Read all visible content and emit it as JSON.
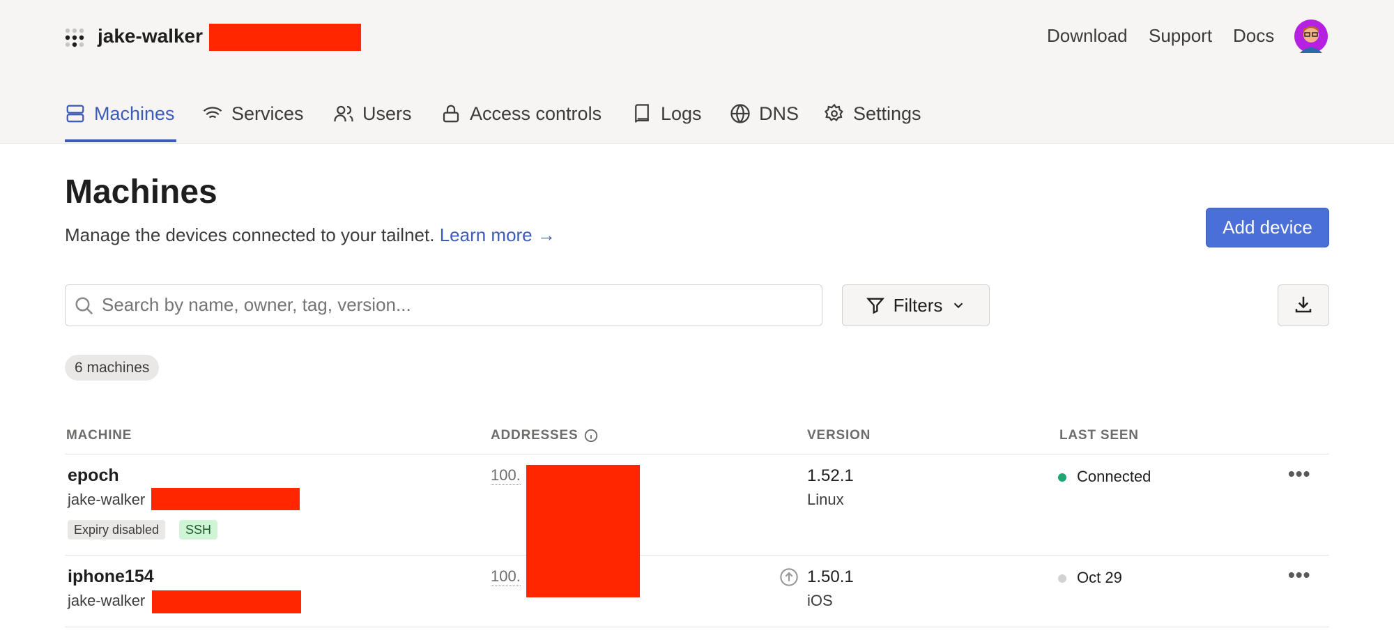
{
  "header": {
    "tailnet_name": "jake-walker",
    "links": [
      "Download",
      "Support",
      "Docs"
    ]
  },
  "nav": {
    "tabs": [
      {
        "label": "Machines",
        "icon": "server-icon",
        "active": true
      },
      {
        "label": "Services",
        "icon": "wifi-icon"
      },
      {
        "label": "Users",
        "icon": "users-icon"
      },
      {
        "label": "Access controls",
        "icon": "lock-icon"
      },
      {
        "label": "Logs",
        "icon": "book-icon"
      },
      {
        "label": "DNS",
        "icon": "globe-icon"
      },
      {
        "label": "Settings",
        "icon": "gear-icon"
      }
    ]
  },
  "page": {
    "title": "Machines",
    "subtitle": "Manage the devices connected to your tailnet.",
    "learn_more": "Learn more →",
    "add_device": "Add device"
  },
  "search": {
    "placeholder": "Search by name, owner, tag, version..."
  },
  "filters_label": "Filters",
  "count_badge": "6 machines",
  "table": {
    "headers": [
      "MACHINE",
      "ADDRESSES",
      "VERSION",
      "LAST SEEN"
    ],
    "rows": [
      {
        "name": "epoch",
        "owner": "jake-walker",
        "tags": [
          "Expiry disabled",
          "SSH"
        ],
        "address": "100.",
        "version": "1.52.1",
        "os": "Linux",
        "last_seen": "Connected",
        "status": "online"
      },
      {
        "name": "iphone154",
        "owner": "jake-walker",
        "tags": [],
        "address": "100.",
        "version": "1.50.1",
        "os": "iOS",
        "last_seen": "Oct 29",
        "status": "offline",
        "update_available": true
      }
    ]
  },
  "colors": {
    "accent": "#3d5bb8",
    "button": "#4a6fd6",
    "online": "#1ea672",
    "offline": "#d4d2d0",
    "header_bg": "#f6f5f3"
  }
}
